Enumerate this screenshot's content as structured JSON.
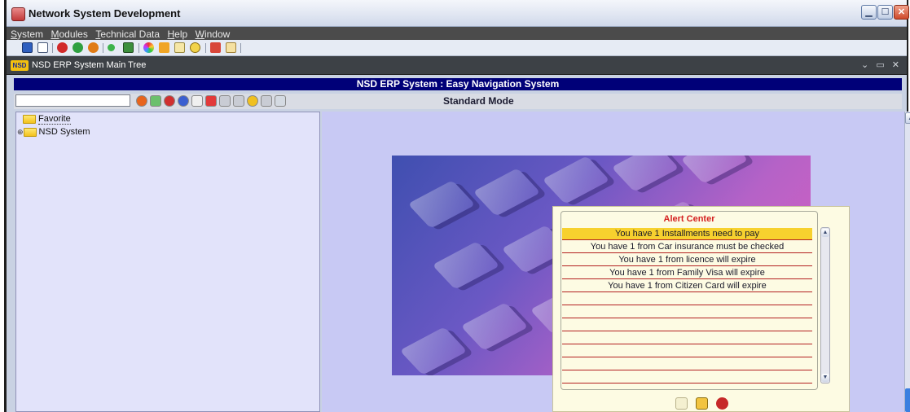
{
  "window": {
    "title": "Network System Development",
    "controls": [
      "minimize",
      "maximize",
      "close"
    ]
  },
  "menu": {
    "items": [
      {
        "label": "System",
        "underline": "S"
      },
      {
        "label": "Modules",
        "underline": "M"
      },
      {
        "label": "Technical Data",
        "underline": "T"
      },
      {
        "label": "Help",
        "underline": "H"
      },
      {
        "label": "Window",
        "underline": "W"
      }
    ]
  },
  "toolbar": {
    "icons": [
      "save-icon",
      "new-icon",
      "delete-icon",
      "confirm-icon",
      "cancel-icon",
      "record-icon",
      "report-icon",
      "color-icon",
      "tools-icon",
      "list-icon",
      "help-icon",
      "edit-icon",
      "preview-icon"
    ]
  },
  "tree_window": {
    "logo": "NSD",
    "title": "NSD ERP System Main Tree",
    "controls": "⌄ ▭ ✕"
  },
  "nav": {
    "header": "NSD ERP System : Easy Navigation System",
    "search_value": "",
    "mode": "Standard Mode",
    "buttons": [
      "check-icon",
      "grid-icon",
      "globe-icon",
      "wand-icon",
      "pencil-icon",
      "form-icon",
      "window-icon",
      "panel-icon",
      "info-icon",
      "refresh-icon"
    ]
  },
  "tree": {
    "nodes": [
      {
        "label": "Favorite",
        "expanded": false
      },
      {
        "label": "NSD System",
        "expanded": false
      }
    ]
  },
  "alert_center": {
    "title": "Alert Center",
    "rows": [
      "You have 1 Installments need to pay",
      "You have  1  from Car insurance must be checked",
      "You have 1 from licence will expire",
      "You have 1 from Family Visa will expire",
      "You have 1 from Citizen Card will expire",
      "",
      "",
      "",
      "",
      "",
      "",
      ""
    ],
    "selected_row": 0,
    "buttons": [
      "wand-icon",
      "filter-icon",
      "close-icon"
    ]
  },
  "colors": {
    "nav_header": "#000078",
    "selected_alert": "#f7d12e",
    "alert_title": "#d42020"
  }
}
